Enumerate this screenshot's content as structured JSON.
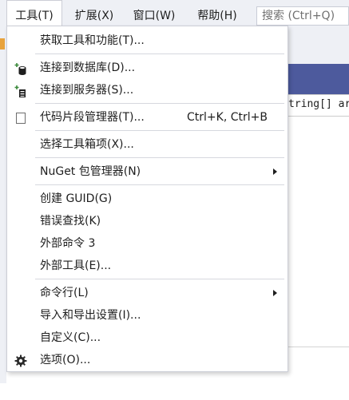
{
  "menubar": {
    "items": [
      {
        "label": "工具(T)",
        "active": true
      },
      {
        "label": "扩展(X)"
      },
      {
        "label": "窗口(W)"
      },
      {
        "label": "帮助(H)"
      }
    ],
    "search_placeholder": "搜索 (Ctrl+Q)"
  },
  "background": {
    "code_fragment": "tring[] args"
  },
  "menu": {
    "items": [
      {
        "label": "获取工具和功能(T)..."
      },
      {
        "label": "连接到数据库(D)...",
        "icon": "database-add-icon"
      },
      {
        "label": "连接到服务器(S)...",
        "icon": "server-add-icon"
      },
      {
        "label": "代码片段管理器(T)...",
        "shortcut": "Ctrl+K, Ctrl+B",
        "icon": "snippet-checkbox-icon"
      },
      {
        "label": "选择工具箱项(X)..."
      },
      {
        "label": "NuGet 包管理器(N)",
        "submenu": true
      },
      {
        "label": "创建 GUID(G)"
      },
      {
        "label": "错误查找(K)"
      },
      {
        "label": "外部命令 3"
      },
      {
        "label": "外部工具(E)..."
      },
      {
        "label": "命令行(L)",
        "submenu": true
      },
      {
        "label": "导入和导出设置(I)..."
      },
      {
        "label": "自定义(C)..."
      },
      {
        "label": "选项(O)...",
        "icon": "gear-icon"
      }
    ]
  },
  "colors": {
    "menubar_bg": "#eef0f5",
    "menu_bg": "#ffffff",
    "accent_blue": "#4d5a9d",
    "icon_green": "#3c8a3c"
  }
}
